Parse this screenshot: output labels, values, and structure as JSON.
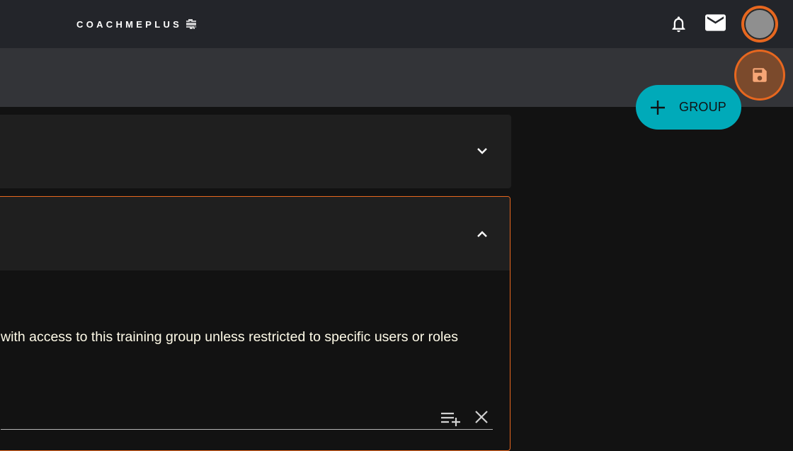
{
  "header": {
    "logo_text": "COACHMEPLUS",
    "icons": [
      "notifications-icon",
      "mail-icon",
      "avatar"
    ]
  },
  "actions": {
    "add_group_label": "GROUP",
    "save_icon": "save-icon"
  },
  "sections": [
    {
      "expanded": false,
      "chevron": "chevron-down-icon"
    },
    {
      "expanded": true,
      "chevron": "chevron-up-icon",
      "description": "with access to this training group unless restricted to specific users or roles",
      "field_actions": [
        "playlist-add-icon",
        "clear-icon"
      ]
    }
  ],
  "colors": {
    "accent_orange": "#e7671f",
    "group_button": "#00aab9",
    "topbar": "#23252a",
    "subbar": "#333438",
    "panel": "#1f1f1f",
    "background": "#121212"
  }
}
